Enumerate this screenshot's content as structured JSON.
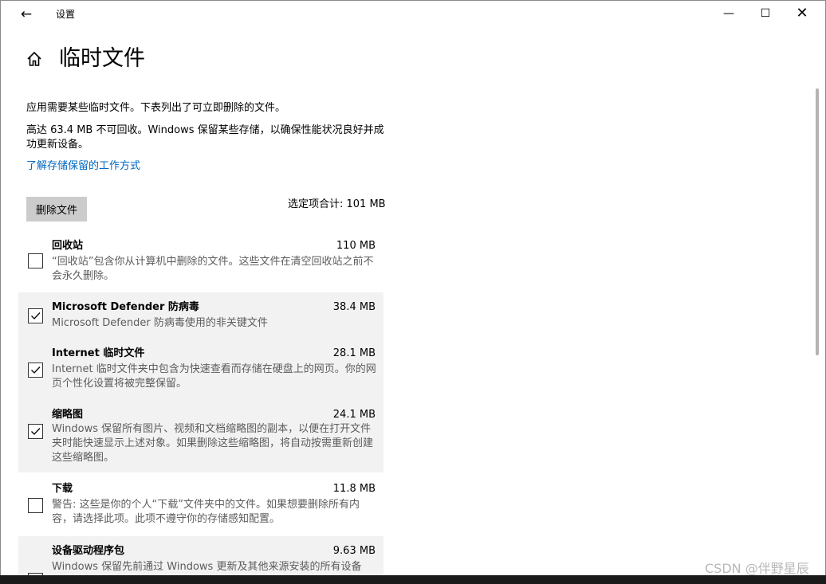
{
  "window": {
    "title": "设置",
    "back_icon": "←",
    "minimize_icon": "—",
    "maximize_icon": "☐",
    "close_icon": "✕"
  },
  "header": {
    "title": "临时文件",
    "home_icon": "home-icon"
  },
  "description": {
    "line1": "应用需要某些临时文件。下表列出了可立即删除的文件。",
    "line2": "高达 63.4 MB 不可回收。Windows 保留某些存储，以确保性能状况良好并成功更新设备。",
    "link": "了解存储保留的工作方式"
  },
  "actions": {
    "delete_label": "删除文件",
    "total_label": "选定项合计: 101 MB"
  },
  "items": [
    {
      "name": "回收站",
      "size": "110 MB",
      "checked": false,
      "desc": "“回收站”包含你从计算机中删除的文件。这些文件在清空回收站之前不会永久删除。"
    },
    {
      "name": "Microsoft Defender 防病毒",
      "size": "38.4 MB",
      "checked": true,
      "desc": "Microsoft Defender 防病毒使用的非关键文件"
    },
    {
      "name": "Internet 临时文件",
      "size": "28.1 MB",
      "checked": true,
      "desc": "Internet 临时文件夹中包含为快速查看而存储在硬盘上的网页。你的网页个性化设置将被完整保留。"
    },
    {
      "name": "缩略图",
      "size": "24.1 MB",
      "checked": true,
      "desc": "Windows 保留所有图片、视频和文档缩略图的副本，以便在打开文件夹时能快速显示上述对象。如果删除这些缩略图，将自动按需重新创建这些缩略图。"
    },
    {
      "name": "下载",
      "size": "11.8 MB",
      "checked": false,
      "desc": "警告: 这些是你的个人“下载”文件夹中的文件。如果想要删除所有内容，请选择此项。此项不遵守你的存储感知配置。"
    },
    {
      "name": "设备驱动程序包",
      "size": "9.63 MB",
      "checked": false,
      "desc": "Windows 保留先前通过 Windows 更新及其他来源安装的所有设备"
    }
  ],
  "watermark": "CSDN @伴野星辰",
  "colors": {
    "link": "#0067c0",
    "checked_bg": "#f2f2f2",
    "button_bg": "#cccccc"
  }
}
